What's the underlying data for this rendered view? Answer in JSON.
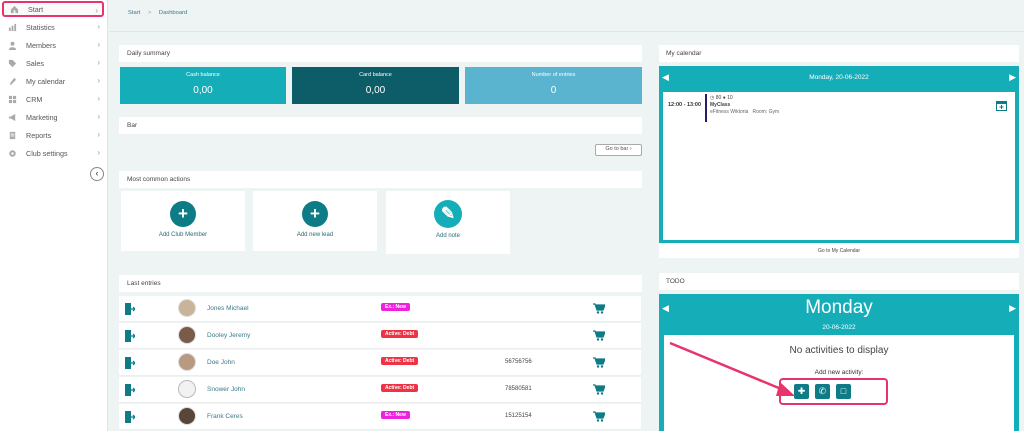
{
  "sidebar": {
    "items": [
      {
        "label": "Start",
        "icon": "home-icon"
      },
      {
        "label": "Statistics",
        "icon": "bar-chart-icon"
      },
      {
        "label": "Members",
        "icon": "person-icon"
      },
      {
        "label": "Sales",
        "icon": "tag-icon"
      },
      {
        "label": "My calendar",
        "icon": "pen-icon"
      },
      {
        "label": "CRM",
        "icon": "grid-icon"
      },
      {
        "label": "Marketing",
        "icon": "megaphone-icon"
      },
      {
        "label": "Reports",
        "icon": "report-icon"
      },
      {
        "label": "Club settings",
        "icon": "gear-icon"
      }
    ],
    "collapse_icon": "chevron-left-icon"
  },
  "breadcrumb": {
    "start": "Start",
    "sep": ">",
    "current": "Dashboard"
  },
  "daily_summary": {
    "title": "Daily summary",
    "cards": [
      {
        "title": "Cash balance",
        "value": "0,00",
        "color": "#15aeb8"
      },
      {
        "title": "Card balance",
        "value": "0,00",
        "color": "#0d5d68"
      },
      {
        "title": "Number of entries",
        "value": "0",
        "color": "#5ab3cf"
      }
    ]
  },
  "bar": {
    "title": "Bar",
    "button": "Go to bar"
  },
  "common_actions": {
    "title": "Most common actions",
    "items": [
      {
        "label": "Add Club Member",
        "glyph": "+"
      },
      {
        "label": "Add new lead",
        "glyph": "+"
      },
      {
        "label": "Add note",
        "glyph": "✎"
      }
    ]
  },
  "last_entries": {
    "title": "Last entries",
    "rows": [
      {
        "name": "Jones Michael",
        "badge": "Ex.: New",
        "badge_color": "#ee22dd",
        "phone": ""
      },
      {
        "name": "Dooley Jeremy",
        "badge": "Active: Debt",
        "badge_color": "#ee3344",
        "phone": ""
      },
      {
        "name": "Doe John",
        "badge": "Active: Debt",
        "badge_color": "#ee3344",
        "phone": "56756756"
      },
      {
        "name": "Snower John",
        "badge": "Active: Debt",
        "badge_color": "#ee3344",
        "phone": "78580581"
      },
      {
        "name": "Frank Ceres",
        "badge": "Ex.: New",
        "badge_color": "#ee22dd",
        "phone": "15125154"
      }
    ]
  },
  "calendar": {
    "title": "My calendar",
    "date": "Monday, 20-06-2022",
    "event": {
      "time": "12:00 - 13:00",
      "capacity": "80",
      "booked": "10",
      "name": "MyClass",
      "details": "eFitness Wiktoria   Room: Gym"
    },
    "footer_link": "Go to My Calendar"
  },
  "todo": {
    "title": "TODO",
    "day": "Monday",
    "date": "20-06-2022",
    "empty": "No activities to display",
    "add_label": "Add new activity:",
    "accent": "#e8336b"
  },
  "colors": {
    "teal": "#15aeb8",
    "dark_teal": "#0e7c86",
    "highlight": "#e8336b"
  }
}
